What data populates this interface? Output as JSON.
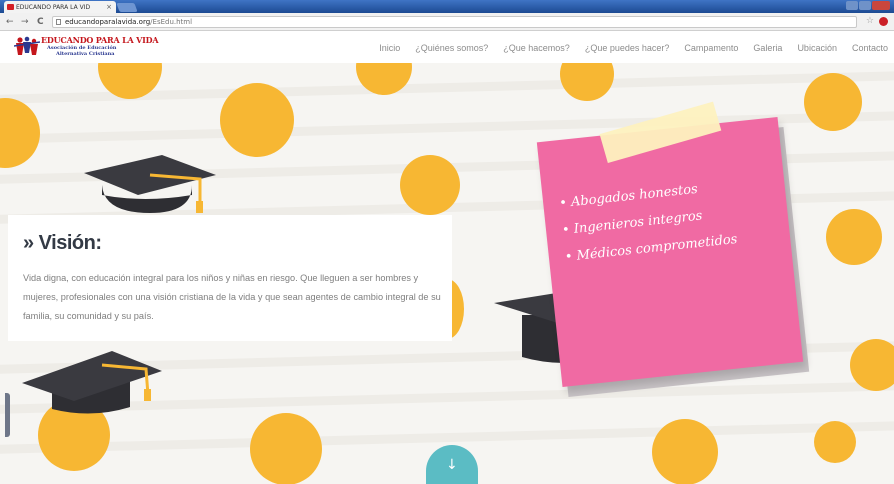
{
  "browser": {
    "tab_title": "EDUCANDO PARA LA VID",
    "tab_close": "×",
    "back": "←",
    "forward": "→",
    "reload": "C",
    "url_domain": "educandoparalavida.org",
    "url_path": "/EsEdu.html",
    "star": "☆"
  },
  "logo": {
    "title": "EDUCANDO PARA LA VIDA",
    "line1": "Asociación de Educación",
    "line2": "Alternativa Cristiana"
  },
  "nav": {
    "items": [
      "Inicio",
      "¿Quiénes somos?",
      "¿Que hacemos?",
      "¿Que puedes hacer?",
      "Campamento",
      "Galeria",
      "Ubicación",
      "Contacto"
    ]
  },
  "vision": {
    "title": "» Visión:",
    "text": "Vida digna, con educación integral para los niños y niñas en riesgo. Que lleguen a ser hombres y mujeres, profesionales con una visión cristiana de la vida y que sean agentes de cambio integral de su familia, su comunidad y su país."
  },
  "note": {
    "items": [
      "Abogados honestos",
      "Ingenieros integros",
      "Médicos comprometidos"
    ]
  },
  "scroll": {
    "arrow": "↓"
  },
  "colors": {
    "dot": "#f7b733",
    "note": "#f06aa3",
    "tape": "#fdf1bf",
    "scroll_button": "#5bbcc4",
    "logo_red": "#c4161c",
    "logo_blue": "#2b3990"
  }
}
